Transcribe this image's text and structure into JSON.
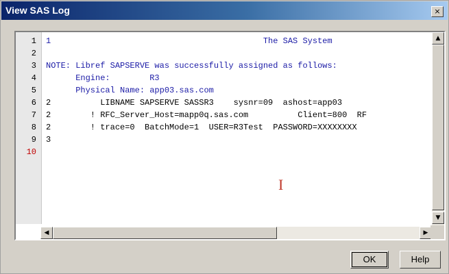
{
  "window": {
    "title": "View SAS Log",
    "close_glyph": "×"
  },
  "log": {
    "line_numbers": [
      "1",
      "2",
      "3",
      "4",
      "5",
      "6",
      "7",
      "8",
      "9",
      "10"
    ],
    "current_line_index": 9,
    "lines": [
      "1                                           The SAS System",
      "",
      "NOTE: Libref SAPSERVE was successfully assigned as follows:",
      "      Engine:        R3",
      "      Physical Name: app03.sas.com",
      "2          LIBNAME SAPSERVE SASSR3    sysnr=09  ashost=app03",
      "2        ! RFC_Server_Host=mapp0q.sas.com          Client=800  RF",
      "2        ! trace=0  BatchMode=1  USER=R3Test  PASSWORD=XXXXXXXX",
      "3",
      ""
    ],
    "line_colors": [
      "blue",
      "blue",
      "blue",
      "blue",
      "blue",
      "black",
      "black",
      "black",
      "black",
      "black"
    ],
    "caret_glyph": "I"
  },
  "scrollbars": {
    "up_glyph": "▲",
    "down_glyph": "▼",
    "left_glyph": "◀",
    "right_glyph": "▶"
  },
  "buttons": {
    "ok_label": "OK",
    "help_label": "Help"
  }
}
